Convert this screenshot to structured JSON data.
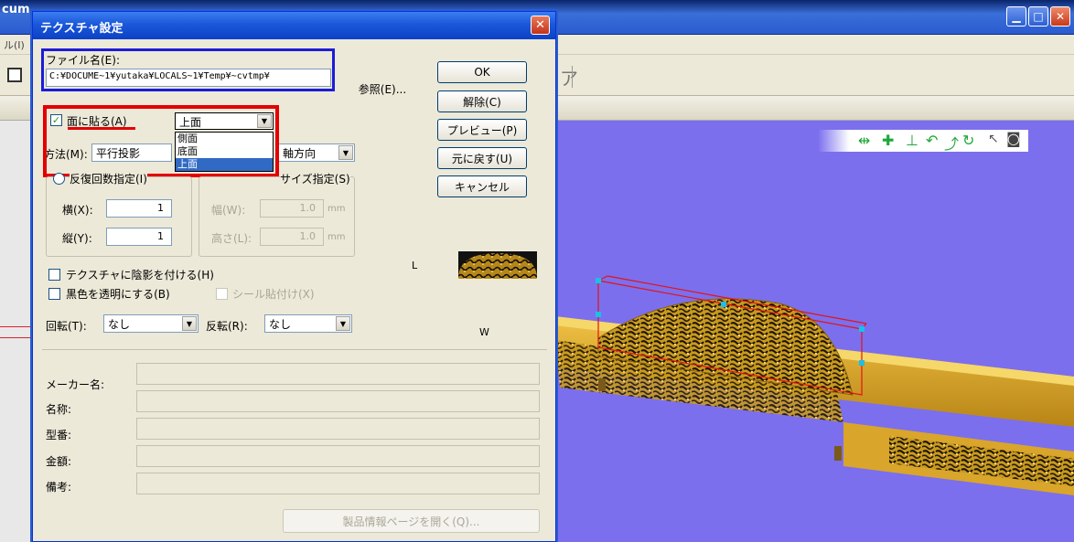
{
  "app": {
    "title_fragment": "cum",
    "menu_fragment": "ル(I)"
  },
  "dialog": {
    "title": "テクスチャ設定",
    "file": {
      "label": "ファイル名(E):",
      "value": "C:¥DOCUME~1¥yutaka¥LOCALS~1¥Temp¥~cvtmp¥",
      "browse_label": "参照(E)..."
    },
    "buttons": {
      "ok": "OK",
      "release": "解除(C)",
      "preview": "プレビュー(P)",
      "revert": "元に戻す(U)",
      "cancel": "キャンセル"
    },
    "paste_face": {
      "label": "面に貼る(A)",
      "checked": true,
      "selected": "上面",
      "options": [
        "側面",
        "底面",
        "上面"
      ],
      "highlighted_option": "上面"
    },
    "method": {
      "label": "方法(M):",
      "value": "平行投影",
      "axis_value": "軸方向"
    },
    "repeat_group": {
      "title": "反復回数指定(I)",
      "horizontal_label": "横(X):",
      "horizontal_value": "1",
      "vertical_label": "縦(Y):",
      "vertical_value": "1"
    },
    "size_group": {
      "title": "サイズ指定(S)",
      "width_label": "幅(W):",
      "width_value": "1.0",
      "height_label": "高さ(L):",
      "height_value": "1.0",
      "unit": "mm"
    },
    "preview_labels": {
      "l": "L",
      "w": "W"
    },
    "options": {
      "shadow_label": "テクスチャに陰影を付ける(H)",
      "transparent_label": "黒色を透明にする(B)",
      "seal_label": "シール貼付け(X)"
    },
    "rotation": {
      "label": "回転(T):",
      "value": "なし"
    },
    "flip": {
      "label": "反転(R):",
      "value": "なし"
    },
    "info": {
      "maker_label": "メーカー名:",
      "name_label": "名称:",
      "model_label": "型番:",
      "price_label": "金額:",
      "note_label": "備考:"
    },
    "product_page_button": "製品情報ページを開く(Q)..."
  },
  "colors": {
    "viewport": "#7b6fee",
    "highlight_blue": "#1c1cd8",
    "highlight_red": "#e40000",
    "xp_blue": "#0c41c6"
  }
}
